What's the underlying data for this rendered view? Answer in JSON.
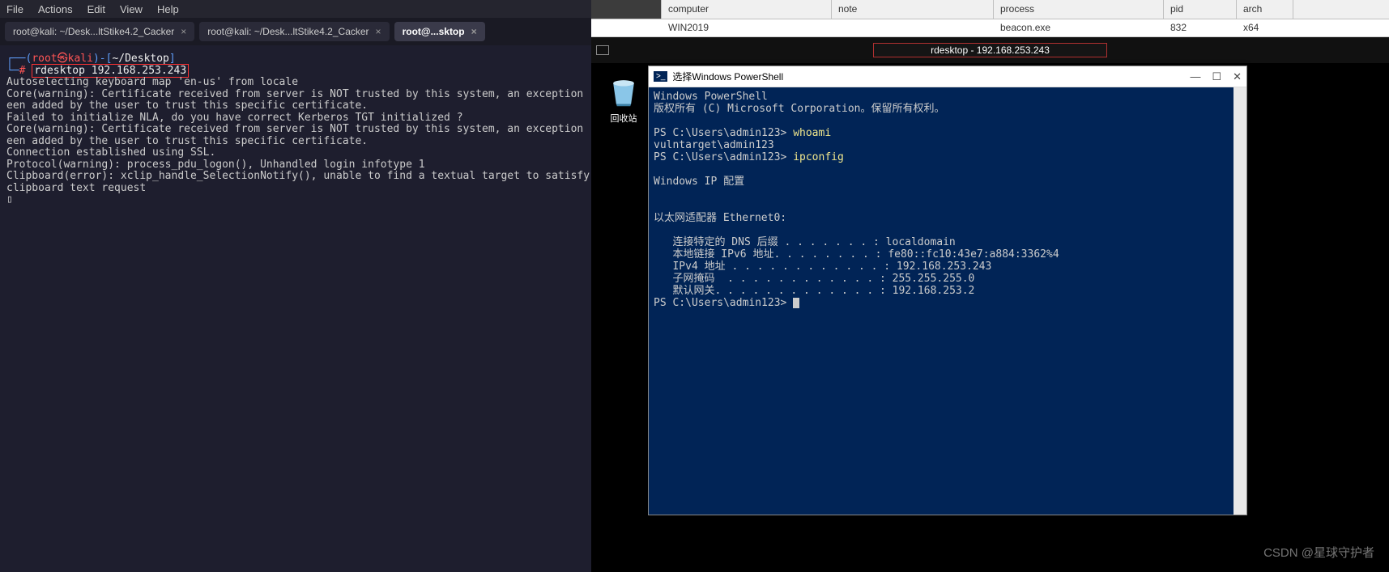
{
  "menu": {
    "file": "File",
    "actions": "Actions",
    "edit": "Edit",
    "view": "View",
    "help": "Help"
  },
  "tabs": [
    {
      "label": "root@kali: ~/Desk...ltStike4.2_Cacker",
      "active": false
    },
    {
      "label": "root@kali: ~/Desk...ltStike4.2_Cacker",
      "active": false
    },
    {
      "label": "root@...sktop",
      "active": true
    }
  ],
  "prompt": {
    "user": "root",
    "host": "kali",
    "path": "~/Desktop",
    "cmd": "rdesktop 192.168.253.243"
  },
  "term_lines": [
    "Autoselecting keyboard map 'en-us' from locale",
    "Core(warning): Certificate received from server is NOT trusted by this system, an exception",
    "een added by the user to trust this specific certificate.",
    "Failed to initialize NLA, do you have correct Kerberos TGT initialized ?",
    "Core(warning): Certificate received from server is NOT trusted by this system, an exception",
    "een added by the user to trust this specific certificate.",
    "Connection established using SSL.",
    "Protocol(warning): process_pdu_logon(), Unhandled login infotype 1",
    "Clipboard(error): xclip_handle_SelectionNotify(), unable to find a textual target to satisfy",
    "clipboard text request"
  ],
  "table": {
    "headers": {
      "computer": "computer",
      "note": "note",
      "process": "process",
      "pid": "pid",
      "arch": "arch"
    },
    "row": {
      "computer": "WIN2019",
      "note": "",
      "process": "beacon.exe",
      "pid": "832",
      "arch": "x64"
    }
  },
  "rdesktop_title": "rdesktop - 192.168.253.243",
  "recycle_label": "回收站",
  "ps": {
    "title_prefix": "选择",
    "title": "Windows PowerShell",
    "ctrl": {
      "min": "—",
      "max": "☐",
      "close": "✕"
    },
    "banner1": "Windows PowerShell",
    "banner2": "版权所有 (C) Microsoft Corporation。保留所有权利。",
    "prompt": "PS C:\\Users\\admin123> ",
    "cmd1": "whoami",
    "out1": "vulntarget\\admin123",
    "cmd2": "ipconfig",
    "ip_header": "Windows IP 配置",
    "adapter": "以太网适配器 Ethernet0:",
    "dns_line": "   连接特定的 DNS 后缀 . . . . . . . : localdomain",
    "ipv6_line": "   本地链接 IPv6 地址. . . . . . . . : fe80::fc10:43e7:a884:3362%4",
    "ipv4_line": "   IPv4 地址 . . . . . . . . . . . . : 192.168.253.243",
    "mask_line": "   子网掩码  . . . . . . . . . . . . : 255.255.255.0",
    "gw_line": "   默认网关. . . . . . . . . . . . . : 192.168.253.2"
  },
  "watermark": "CSDN @星球守护者"
}
